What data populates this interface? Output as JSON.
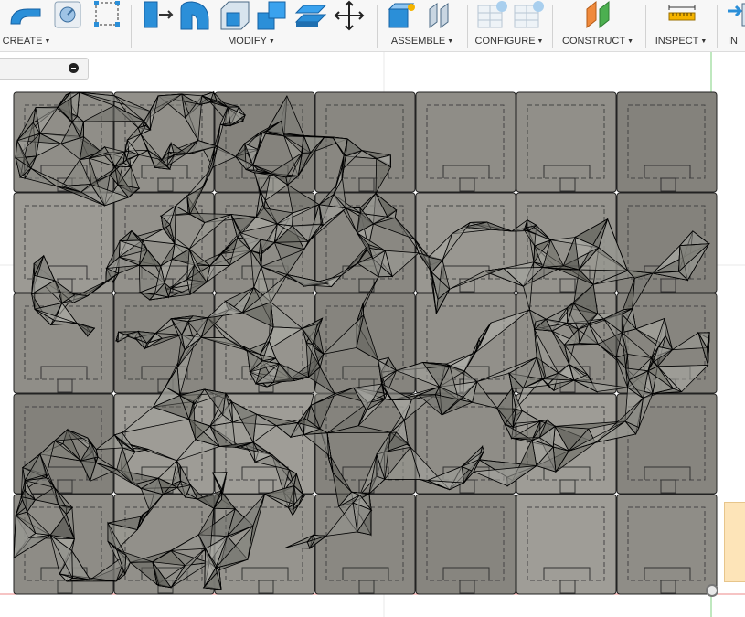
{
  "toolbar": {
    "groups": [
      {
        "label": "CREATE",
        "tools": [
          "extrude-icon",
          "revolve-icon",
          "box-icon",
          "sketch-icon"
        ]
      },
      {
        "label": "MODIFY",
        "tools": [
          "press-pull-icon",
          "fillet-icon",
          "shell-icon",
          "combine-icon",
          "offset-face-icon",
          "move-icon"
        ]
      },
      {
        "label": "ASSEMBLE",
        "tools": [
          "new-component-icon",
          "joint-icon"
        ]
      },
      {
        "label": "CONFIGURE",
        "tools": [
          "configure-table-icon",
          "configure-settings-icon"
        ]
      },
      {
        "label": "CONSTRUCT",
        "tools": [
          "offset-plane-icon"
        ]
      },
      {
        "label": "INSPECT",
        "tools": [
          "measure-icon"
        ]
      },
      {
        "label": "IN",
        "tools": [
          "insert-icon"
        ]
      }
    ]
  },
  "viewport": {
    "grid": {
      "columns": 7,
      "rows": 5
    },
    "background_color": "#ffffff",
    "tile_color": "#8b8a84",
    "mesh_color": "#000000"
  }
}
